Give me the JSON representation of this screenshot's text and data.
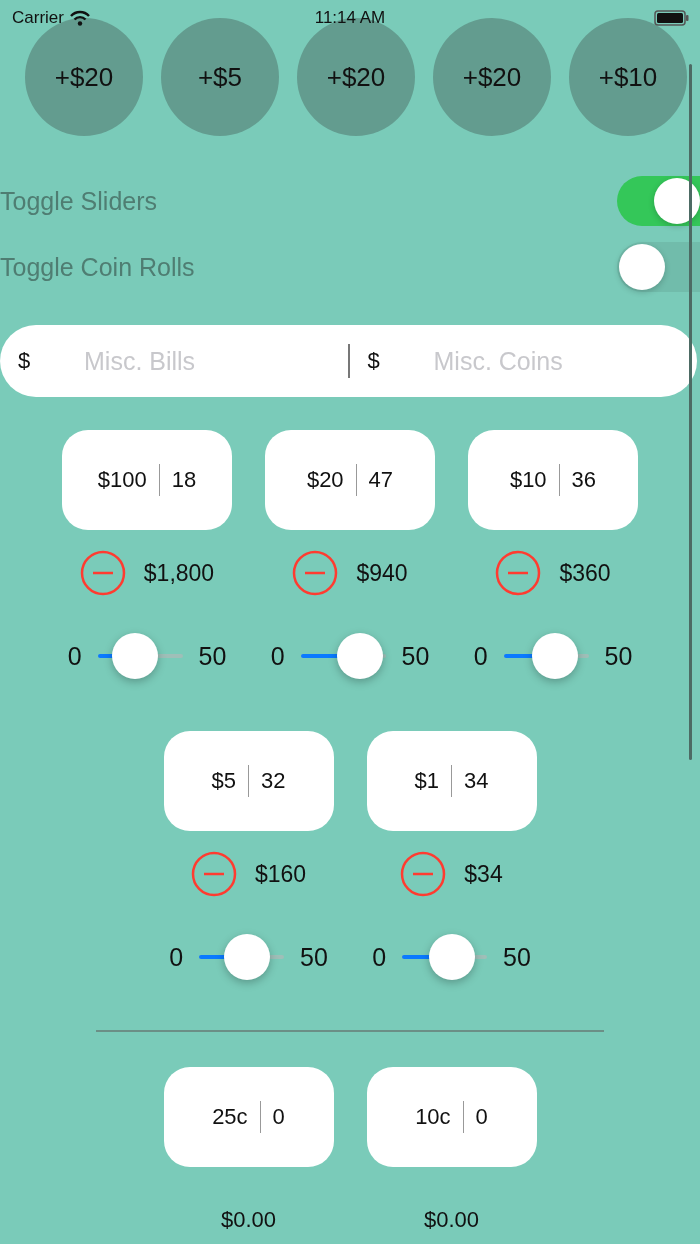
{
  "status_bar": {
    "carrier": "Carrier",
    "time": "11:14 AM"
  },
  "quick_add": [
    {
      "label": "+$20"
    },
    {
      "label": "+$5"
    },
    {
      "label": "+$20"
    },
    {
      "label": "+$20"
    },
    {
      "label": "+$10"
    }
  ],
  "toggles": [
    {
      "label": "Toggle Sliders",
      "on": true
    },
    {
      "label": "Toggle Coin Rolls",
      "on": false
    }
  ],
  "misc_fields": [
    {
      "currency": "$",
      "placeholder": "Misc. Bills"
    },
    {
      "currency": "$",
      "placeholder": "Misc. Coins"
    }
  ],
  "bill_rows": [
    [
      {
        "denomination": "$100",
        "count": "18",
        "total": "$1,800",
        "slider": {
          "min": "0",
          "max": "50",
          "level": 0.36
        }
      },
      {
        "denomination": "$20",
        "count": "47",
        "total": "$940",
        "slider": {
          "min": "0",
          "max": "50",
          "level": 0.94
        }
      },
      {
        "denomination": "$10",
        "count": "36",
        "total": "$360",
        "slider": {
          "min": "0",
          "max": "50",
          "level": 0.72
        }
      }
    ],
    [
      {
        "denomination": "$5",
        "count": "32",
        "total": "$160",
        "slider": {
          "min": "0",
          "max": "50",
          "level": 0.64
        }
      },
      {
        "denomination": "$1",
        "count": "34",
        "total": "$34",
        "slider": {
          "min": "0",
          "max": "50",
          "level": 0.68
        }
      }
    ]
  ],
  "coins": [
    {
      "denomination": "25c",
      "count": "0",
      "total": "$0.00"
    },
    {
      "denomination": "10c",
      "count": "0",
      "total": "$0.00"
    }
  ]
}
